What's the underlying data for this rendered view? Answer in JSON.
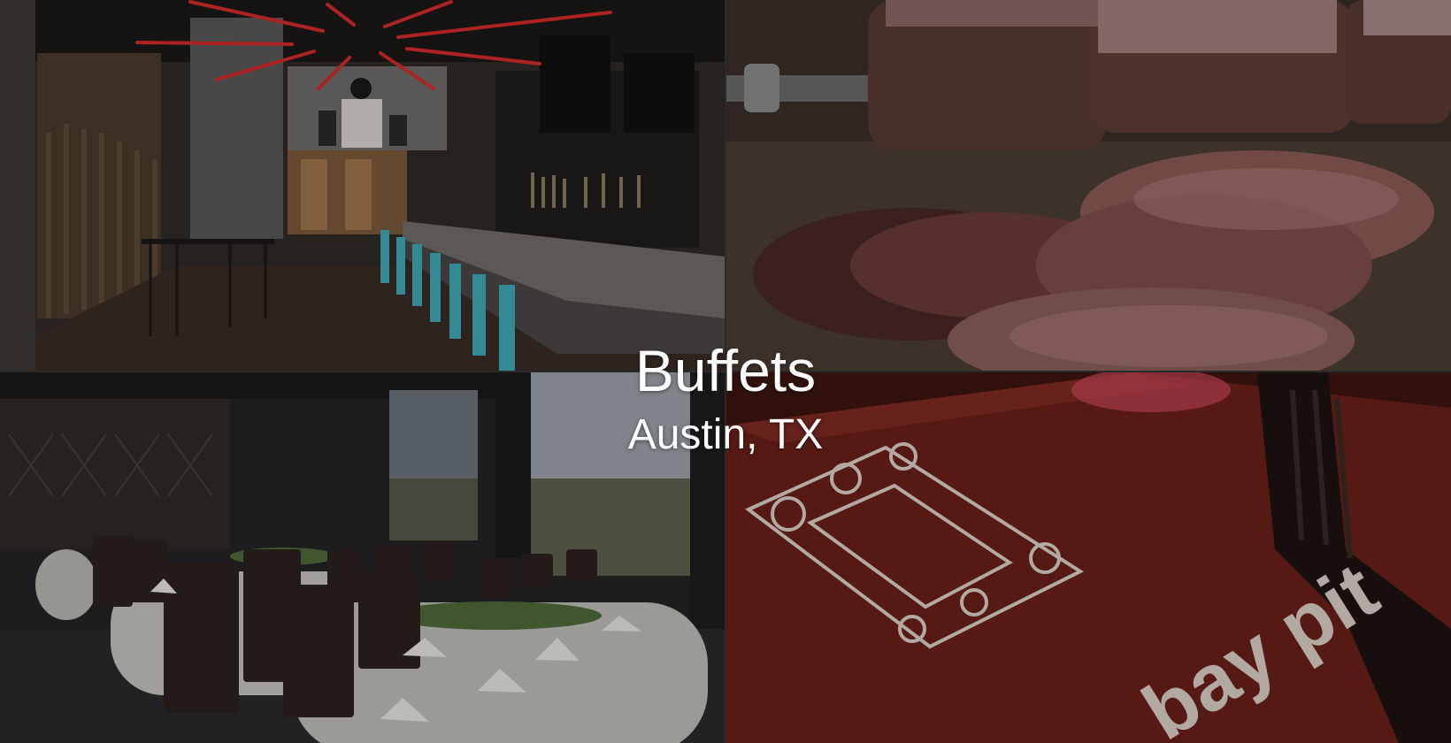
{
  "hero": {
    "title": "Buffets",
    "subtitle": "Austin, TX"
  },
  "tiles": [
    {
      "name": "restaurant-bar-photo",
      "tone": "#3a3531"
    },
    {
      "name": "steak-photo",
      "tone": "#4a3430"
    },
    {
      "name": "private-dining-room-photo",
      "tone": "#2b2a2c"
    },
    {
      "name": "menu-cover-photo",
      "tone": "#5a1e18"
    }
  ],
  "menu_logo_text": "bay pit",
  "colors": {
    "caption_text": "#ffffff",
    "bar_stool_teal": "#3fa9b6",
    "neon_red": "#d32a2a",
    "menu_red": "#6b1f18"
  }
}
